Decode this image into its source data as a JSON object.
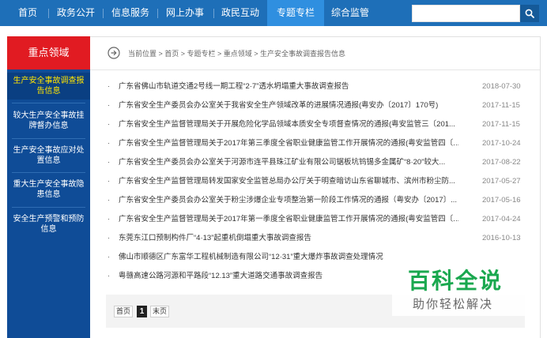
{
  "nav": {
    "items": [
      "首页",
      "政务公开",
      "信息服务",
      "网上办事",
      "政民互动",
      "专题专栏",
      "综合监管"
    ],
    "active_index": 5
  },
  "search": {
    "placeholder": "",
    "icon": "search-icon"
  },
  "sidebar": {
    "heading": "重点领域",
    "items": [
      "生产安全事故调查报告信息",
      "较大生产安全事故挂牌督办信息",
      "生产安全事故应对处置信息",
      "重大生产安全事故隐患信息",
      "安全生产预警和预防信息"
    ],
    "active_index": 0
  },
  "breadcrumb": {
    "text": "当前位置 > 首页 > 专题专栏 > 重点领域 > 生产安全事故调查报告信息",
    "icon": "arrow-circle-icon"
  },
  "news": [
    {
      "title": "广东省佛山市轨道交通2号线一期工程“2·7”透水坍塌重大事故调查报告",
      "date": "2018-07-30"
    },
    {
      "title": "广东省安全生产委员会办公室关于我省安全生产领域改革的进展情况通报(粤安办〔2017〕170号)",
      "date": "2017-11-15"
    },
    {
      "title": "广东省安全生产监督管理局关于开展危险化学品领域本质安全专项督查情况的通报(粤安监管三〔201...",
      "date": "2017-11-15"
    },
    {
      "title": "广东省安全生产监督管理局关于2017年第三季度全省职业健康监管工作开展情况的通报(粤安监管四〔...",
      "date": "2017-10-24"
    },
    {
      "title": "广东省安全生产委员会办公室关于河源市连平县珠江矿业有限公司锯板坑钨锡多金属矿“8·20”较大...",
      "date": "2017-08-22"
    },
    {
      "title": "广东省安全生产监督管理局转发国家安全监管总局办公厅关于明查暗访山东省聊城市、滨州市粉尘防...",
      "date": "2017-05-27"
    },
    {
      "title": "广东省安全生产委员会办公室关于粉尘涉爆企业专项整治第一阶段工作情况的通报（粤安办〔2017〕...",
      "date": "2017-05-16"
    },
    {
      "title": "广东省安全生产监督管理局关于2017年第一季度全省职业健康监管工作开展情况的通报(粤安监管四〔...",
      "date": "2017-04-24"
    },
    {
      "title": "东莞东江口预制构件厂“4·13”起重机倒塌重大事故调查报告",
      "date": "2016-10-13"
    },
    {
      "title": "佛山市顺德区广东富华工程机械制造有限公司“12·31”重大爆炸事故调查处理情况",
      "date": ""
    },
    {
      "title": "粤赣高速公路河源和平路段“12.13”重大道路交通事故调查报告",
      "date": ""
    }
  ],
  "pager": {
    "first": "首页",
    "current": "1",
    "last": "末页"
  },
  "watermark": {
    "big": "百科全说",
    "small": "助你轻松解决"
  },
  "colors": {
    "nav_bg": "#1e6fb8",
    "nav_active": "#2f8fe0",
    "sidebar_bg": "#0f4c97",
    "sidebar_head": "#e11b22",
    "active_text": "#ffe400",
    "watermark_green": "#1aa84f"
  }
}
